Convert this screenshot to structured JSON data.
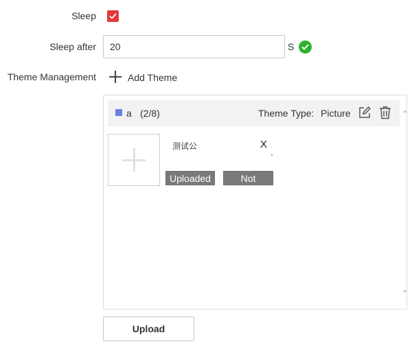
{
  "form": {
    "sleep_label": "Sleep",
    "sleep_checked": true,
    "sleep_after_label": "Sleep after",
    "sleep_after_value": "20",
    "sleep_after_unit": "S",
    "theme_management_label": "Theme Management",
    "add_theme_label": "Add Theme"
  },
  "theme": {
    "swatch_color": "#6b7fe0",
    "name": "a",
    "count": "(2/8)",
    "type_label": "Theme Type:",
    "type_value": "Picture",
    "item": {
      "name": "测试公      ",
      "close_label": "X",
      "status_uploaded": "Uploaded",
      "status_not": "Not"
    }
  },
  "upload_label": "Upload",
  "colors": {
    "checkbox": "#e4393c",
    "valid": "#2db32d",
    "badge": "#7a7a7a"
  },
  "icons": {
    "checkbox": "check-icon",
    "valid": "check-circle-icon",
    "add_theme": "plus-icon",
    "edit": "edit-icon",
    "delete": "trash-icon"
  }
}
